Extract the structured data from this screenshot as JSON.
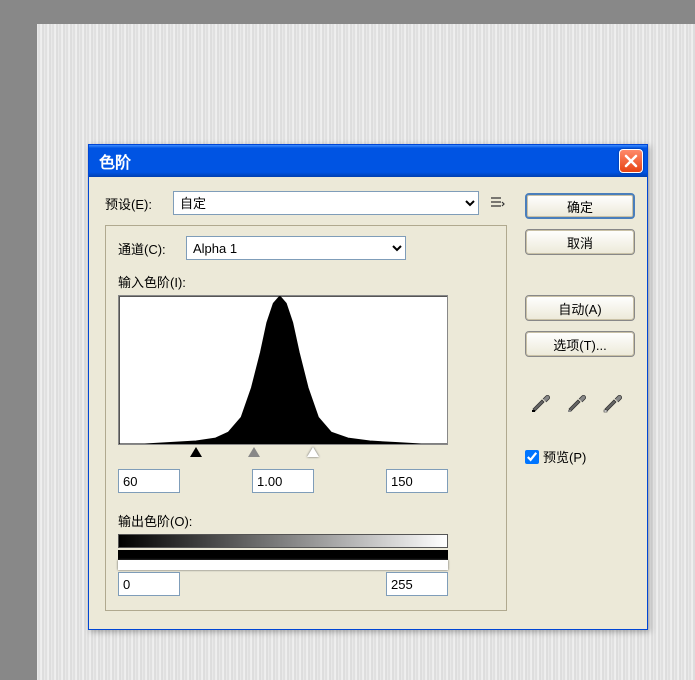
{
  "dialog_title": "色阶",
  "preset": {
    "label": "预设(E):",
    "value": "自定"
  },
  "channel": {
    "label": "通道(C):",
    "value": "Alpha 1"
  },
  "input_levels": {
    "label": "输入色阶(I):",
    "shadow": "60",
    "midtone": "1.00",
    "highlight": "150"
  },
  "output_levels": {
    "label": "输出色阶(O):",
    "low": "0",
    "high": "255"
  },
  "buttons": {
    "ok": "确定",
    "cancel": "取消",
    "auto": "自动(A)",
    "options": "选项(T)..."
  },
  "preview_label": "预览(P)",
  "preview_checked": true,
  "chart_data": {
    "type": "area",
    "title": "",
    "xlabel": "",
    "ylabel": "",
    "xlim": [
      0,
      255
    ],
    "ylim": [
      0,
      1
    ],
    "x": [
      0,
      20,
      40,
      60,
      75,
      85,
      95,
      103,
      110,
      115,
      120,
      125,
      130,
      135,
      140,
      147,
      155,
      165,
      178,
      195,
      215,
      235,
      255
    ],
    "values": [
      0,
      0,
      0.01,
      0.02,
      0.04,
      0.08,
      0.18,
      0.38,
      0.62,
      0.82,
      0.95,
      1.0,
      0.95,
      0.82,
      0.62,
      0.38,
      0.18,
      0.08,
      0.04,
      0.02,
      0.01,
      0,
      0
    ]
  }
}
